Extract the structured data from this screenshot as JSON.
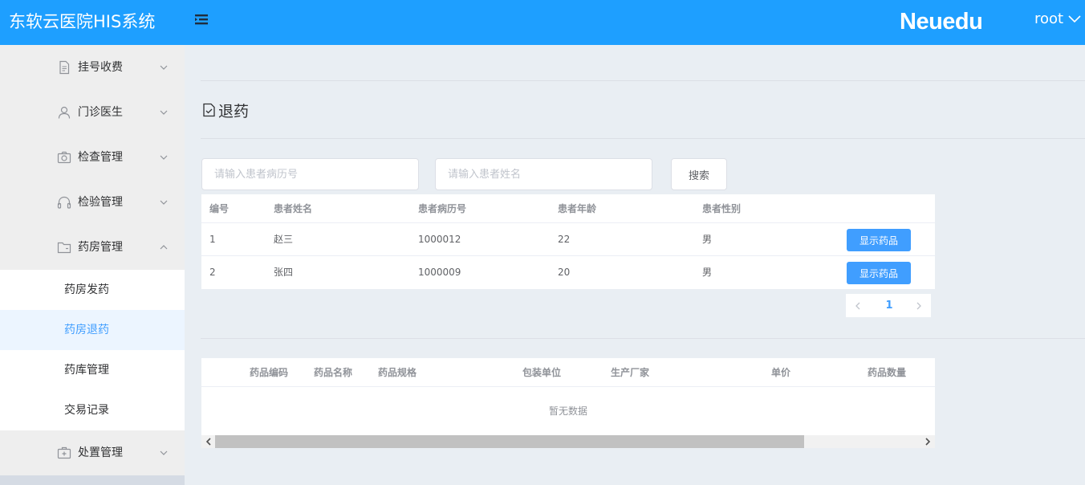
{
  "header": {
    "title": "东软云医院HIS系统",
    "brand": "Neuedu",
    "user": "root",
    "bg_color": "#1e9fff"
  },
  "sidebar": {
    "menus": [
      {
        "label": "挂号收费",
        "icon": "document-icon",
        "expanded": false
      },
      {
        "label": "门诊医生",
        "icon": "user-icon",
        "expanded": false
      },
      {
        "label": "检查管理",
        "icon": "camera-icon",
        "expanded": false
      },
      {
        "label": "检验管理",
        "icon": "headset-icon",
        "expanded": false
      },
      {
        "label": "药房管理",
        "icon": "folder-icon",
        "expanded": true
      },
      {
        "label": "处置管理",
        "icon": "first-aid-kit-icon",
        "expanded": false
      }
    ],
    "submenu": [
      {
        "label": "药房发药",
        "active": false
      },
      {
        "label": "药房退药",
        "active": true
      },
      {
        "label": "药库管理",
        "active": false
      },
      {
        "label": "交易记录",
        "active": false
      }
    ]
  },
  "page": {
    "title": "退药",
    "title_icon": "checked-document-icon"
  },
  "search": {
    "record_placeholder": "请输入患者病历号",
    "name_placeholder": "请输入患者姓名",
    "record_value": "",
    "name_value": "",
    "button": "搜索"
  },
  "patients": {
    "columns": [
      "编号",
      "患者姓名",
      "患者病历号",
      "患者年龄",
      "患者性别"
    ],
    "rows": [
      {
        "id": "1",
        "name": "赵三",
        "record": "1000012",
        "age": "22",
        "gender": "男",
        "action": "显示药品"
      },
      {
        "id": "2",
        "name": "张四",
        "record": "1000009",
        "age": "20",
        "gender": "男",
        "action": "显示药品"
      }
    ]
  },
  "pagination": {
    "current": "1"
  },
  "drugs": {
    "columns": [
      "药品编码",
      "药品名称",
      "药品规格",
      "包装单位",
      "生产厂家",
      "单价",
      "药品数量"
    ],
    "empty_text": "暂无数据"
  },
  "colors": {
    "primary": "#409eff",
    "header": "#1e9fff",
    "active_bg": "#ecf5ff"
  }
}
